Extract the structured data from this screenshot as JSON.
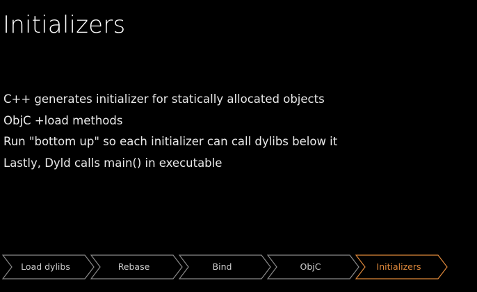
{
  "slide": {
    "title": "Initializers",
    "bullets": [
      "C++ generates initializer for statically allocated objects",
      "ObjC +load methods",
      "Run \"bottom up\" so each initializer can call dylibs below it",
      "Lastly, Dyld calls main() in executable"
    ]
  },
  "progress": {
    "steps": [
      {
        "label": "Load dylibs",
        "active": false
      },
      {
        "label": "Rebase",
        "active": false
      },
      {
        "label": "Bind",
        "active": false
      },
      {
        "label": "ObjC",
        "active": false
      },
      {
        "label": "Initializers",
        "active": true
      }
    ],
    "colors": {
      "inactive_stroke": "#8a8a8a",
      "inactive_text": "#cfcfcf",
      "active_stroke": "#e0893b",
      "active_text": "#e0893b"
    }
  }
}
